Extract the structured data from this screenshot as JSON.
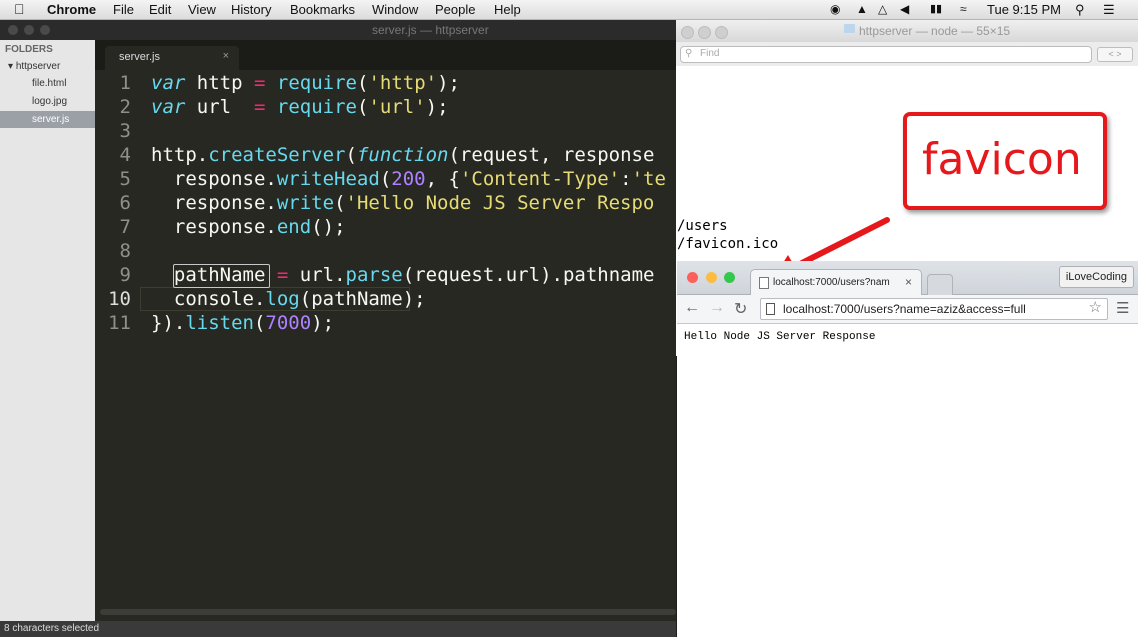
{
  "menubar": {
    "app": "Chrome",
    "items": [
      "File",
      "Edit",
      "View",
      "History",
      "Bookmarks",
      "Window",
      "People",
      "Help"
    ],
    "clock": "Tue 9:15 PM"
  },
  "sublime": {
    "window_title": "server.js — httpserver",
    "sidebar": {
      "header": "FOLDERS",
      "folder": "httpserver",
      "files": [
        "file.html",
        "logo.jpg",
        "server.js"
      ],
      "selected": "server.js"
    },
    "tab": {
      "label": "server.js",
      "close": "×"
    },
    "line_numbers": [
      "1",
      "2",
      "3",
      "4",
      "5",
      "6",
      "7",
      "8",
      "9",
      "10",
      "11"
    ],
    "code_lines": [
      "var http = require('http');",
      "var url  = require('url');",
      "",
      "http.createServer(function(request, response",
      "  response.writeHead(200, {'Content-Type':'te",
      "  response.write('Hello Node JS Server Respo",
      "  response.end();",
      "",
      "  pathName = url.parse(request.url).pathname",
      "  console.log(pathName);",
      "}).listen(7000);"
    ],
    "status": "8 characters selected"
  },
  "terminal": {
    "title": "httpserver — node — 55×15",
    "find_placeholder": "Find",
    "output": [
      "/users",
      "/favicon.ico"
    ]
  },
  "annotation": {
    "text": "favicon"
  },
  "browser": {
    "tab_title": "localhost:7000/users?nam",
    "tab_close": "×",
    "profile": "iLoveCoding",
    "url": "localhost:7000/users?name=aziz&access=full",
    "content": "Hello Node JS Server Response"
  },
  "colors": {
    "annotation": "#e5191c",
    "editor_bg": "#272822",
    "keyword": "#66d9ef",
    "string": "#e6db74",
    "number": "#ae81ff",
    "operator": "#f92672"
  }
}
